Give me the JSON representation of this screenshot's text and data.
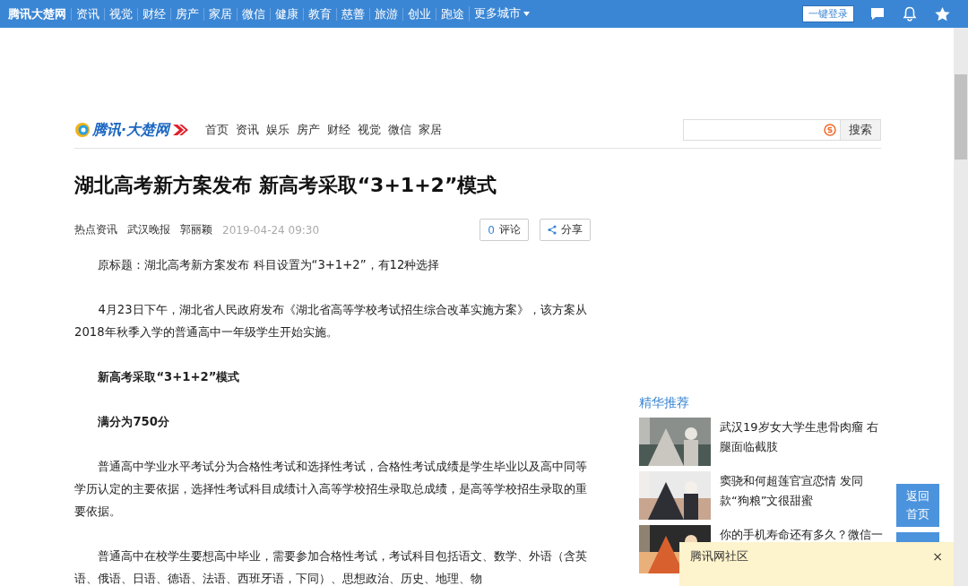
{
  "top_bar": {
    "brand": "腾讯大楚网",
    "links": [
      "资讯",
      "视觉",
      "财经",
      "房产",
      "家居",
      "微信",
      "健康",
      "教育",
      "慈善",
      "旅游",
      "创业",
      "跑途"
    ],
    "more": "更多城市",
    "login": "一键登录"
  },
  "site": {
    "logo": "腾讯·大楚网",
    "nav": [
      "首页",
      "资讯",
      "娱乐",
      "房产",
      "财经",
      "视觉",
      "微信",
      "家居"
    ],
    "search_button": "搜索"
  },
  "article": {
    "title": "湖北高考新方案发布 新高考采取“3+1+2”模式",
    "meta": [
      "热点资讯",
      "武汉晚报",
      "郭丽颖"
    ],
    "time": "2019-04-24 09:30",
    "comment_count": "0",
    "comment_label": "评论",
    "share": "分享",
    "paragraphs": [
      {
        "kind": "text",
        "text": "原标题：湖北高考新方案发布 科目设置为“3+1+2”，有12种选择"
      },
      {
        "kind": "text",
        "text": "4月23日下午，湖北省人民政府发布《湖北省高等学校考试招生综合改革实施方案》，该方案从2018年秋季入学的普通高中一年级学生开始实施。"
      },
      {
        "kind": "heading",
        "text": "新高考采取“3+1+2”模式"
      },
      {
        "kind": "heading",
        "text": "满分为750分"
      },
      {
        "kind": "text",
        "text": "普通高中学业水平考试分为合格性考试和选择性考试，合格性考试成绩是学生毕业以及高中同等学历认定的主要依据，选择性考试科目成绩计入高等学校招生录取总成绩，是高等学校招生录取的重要依据。"
      },
      {
        "kind": "text",
        "text": "普通高中在校学生要想高中毕业，需要参加合格性考试，考试科目包括语文、数学、外语（含英语、俄语、日语、德语、法语、西班牙语，下同）、思想政治、历史、地理、物"
      }
    ]
  },
  "sidebar": {
    "heading": "精华推荐",
    "items": [
      {
        "title": "武汉19岁女大学生患骨肉瘤 右腿面临截肢"
      },
      {
        "title": "窦骁和何超莲官宣恋情 发同款“狗粮”文很甜蜜"
      },
      {
        "title": "你的手机寿命还有多久？微信一"
      }
    ]
  },
  "float_buttons": [
    "返回首页"
  ],
  "popup": {
    "title": "腾讯网社区",
    "close": "×"
  }
}
